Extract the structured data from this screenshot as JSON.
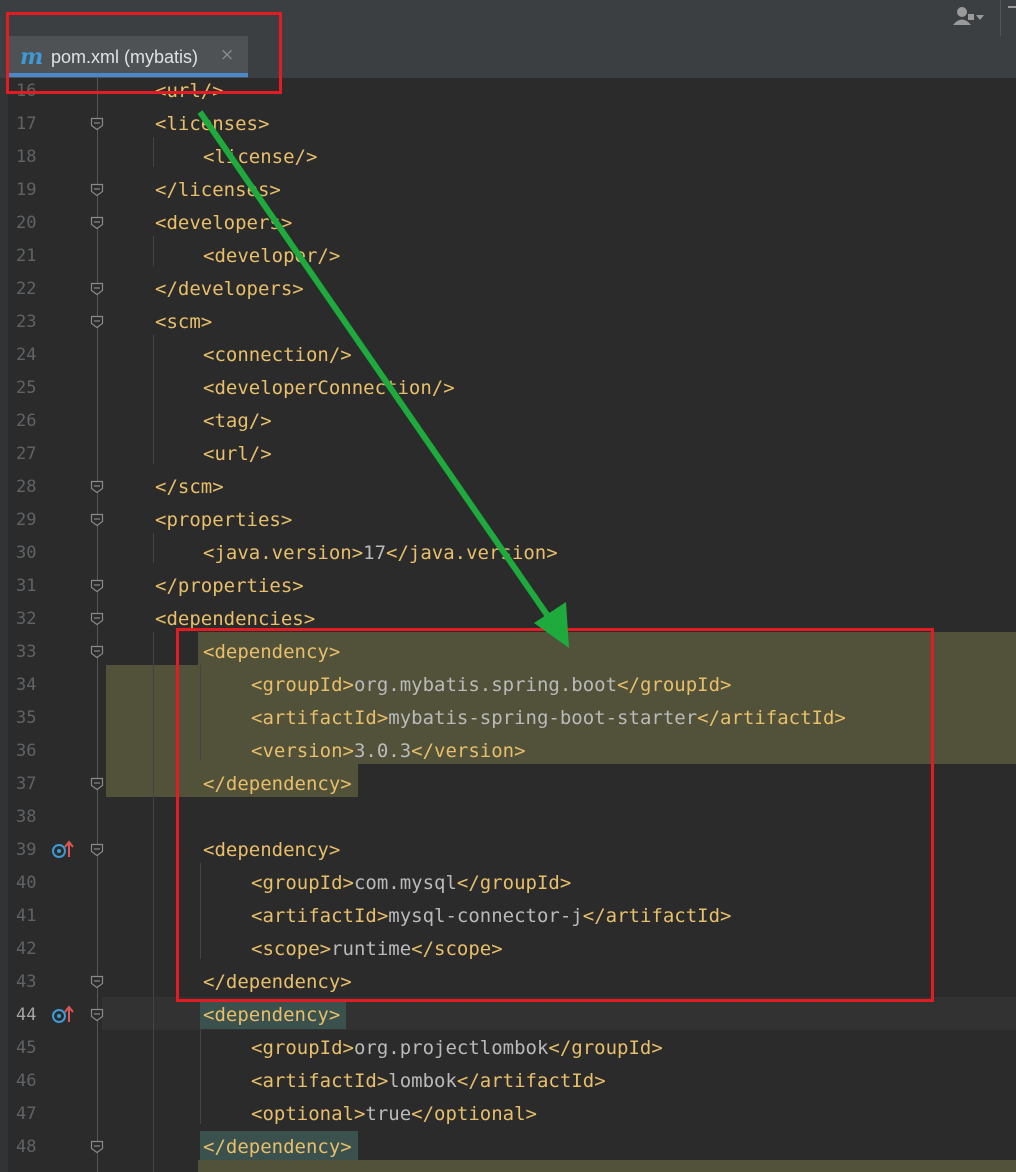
{
  "tab": {
    "icon": "m",
    "label": "pom.xml (mybatis)",
    "close": "×"
  },
  "icons": {
    "user": "user-dropdown-icon",
    "fold": "fold-marker-icon",
    "vcs": "implemented-override-icon"
  },
  "colors": {
    "accent": "#4a88c7",
    "tag": "#e8bf6a",
    "text": "#bababa",
    "highlight": "#525139",
    "annotation_red": "#e31b23",
    "annotation_green": "#1eaa3c"
  },
  "lines": [
    {
      "n": "16",
      "indent": 0,
      "parts": [
        "<url/>"
      ]
    },
    {
      "n": "17",
      "indent": 0,
      "parts": [
        "<licenses>"
      ]
    },
    {
      "n": "18",
      "indent": 1,
      "parts": [
        "<license/>"
      ]
    },
    {
      "n": "19",
      "indent": 0,
      "parts": [
        "</licenses>"
      ]
    },
    {
      "n": "20",
      "indent": 0,
      "parts": [
        "<developers>"
      ]
    },
    {
      "n": "21",
      "indent": 1,
      "parts": [
        "<developer/>"
      ]
    },
    {
      "n": "22",
      "indent": 0,
      "parts": [
        "</developers>"
      ]
    },
    {
      "n": "23",
      "indent": 0,
      "parts": [
        "<scm>"
      ]
    },
    {
      "n": "24",
      "indent": 1,
      "parts": [
        "<connection/>"
      ]
    },
    {
      "n": "25",
      "indent": 1,
      "parts": [
        "<developerConnection/>"
      ]
    },
    {
      "n": "26",
      "indent": 1,
      "parts": [
        "<tag/>"
      ]
    },
    {
      "n": "27",
      "indent": 1,
      "parts": [
        "<url/>"
      ]
    },
    {
      "n": "28",
      "indent": 0,
      "parts": [
        "</scm>"
      ]
    },
    {
      "n": "29",
      "indent": 0,
      "parts": [
        "<properties>"
      ]
    },
    {
      "n": "30",
      "indent": 1,
      "parts": [
        "<java.version>",
        "17",
        "</java.version>"
      ]
    },
    {
      "n": "31",
      "indent": 0,
      "parts": [
        "</properties>"
      ]
    },
    {
      "n": "32",
      "indent": 0,
      "parts": [
        "<dependencies>"
      ]
    },
    {
      "n": "33",
      "indent": 1,
      "parts": [
        "<dependency>"
      ]
    },
    {
      "n": "34",
      "indent": 2,
      "parts": [
        "<groupId>",
        "org.mybatis.spring.boot",
        "</groupId>"
      ]
    },
    {
      "n": "35",
      "indent": 2,
      "parts": [
        "<artifactId>",
        "mybatis-spring-boot-starter",
        "</artifactId>"
      ]
    },
    {
      "n": "36",
      "indent": 2,
      "parts": [
        "<version>",
        "3.0.3",
        "</version>"
      ]
    },
    {
      "n": "37",
      "indent": 1,
      "parts": [
        "</dependency>"
      ]
    },
    {
      "n": "38",
      "indent": 0,
      "parts": []
    },
    {
      "n": "39",
      "indent": 1,
      "parts": [
        "<dependency>"
      ]
    },
    {
      "n": "40",
      "indent": 2,
      "parts": [
        "<groupId>",
        "com.mysql",
        "</groupId>"
      ]
    },
    {
      "n": "41",
      "indent": 2,
      "parts": [
        "<artifactId>",
        "mysql-connector-j",
        "</artifactId>"
      ]
    },
    {
      "n": "42",
      "indent": 2,
      "parts": [
        "<scope>",
        "runtime",
        "</scope>"
      ]
    },
    {
      "n": "43",
      "indent": 1,
      "parts": [
        "</dependency>"
      ]
    },
    {
      "n": "44",
      "indent": 1,
      "parts": [
        "<dependency>"
      ]
    },
    {
      "n": "45",
      "indent": 2,
      "parts": [
        "<groupId>",
        "org.projectlombok",
        "</groupId>"
      ]
    },
    {
      "n": "46",
      "indent": 2,
      "parts": [
        "<artifactId>",
        "lombok",
        "</artifactId>"
      ]
    },
    {
      "n": "47",
      "indent": 2,
      "parts": [
        "<optional>",
        "true",
        "</optional>"
      ]
    },
    {
      "n": "48",
      "indent": 1,
      "parts": [
        "</dependency>"
      ]
    }
  ],
  "current_line": "44",
  "folds": [
    "17",
    "19",
    "20",
    "22",
    "23",
    "28",
    "29",
    "31",
    "32",
    "33",
    "37",
    "39",
    "43",
    "44",
    "48"
  ],
  "vcs_marks": [
    "39",
    "44"
  ]
}
